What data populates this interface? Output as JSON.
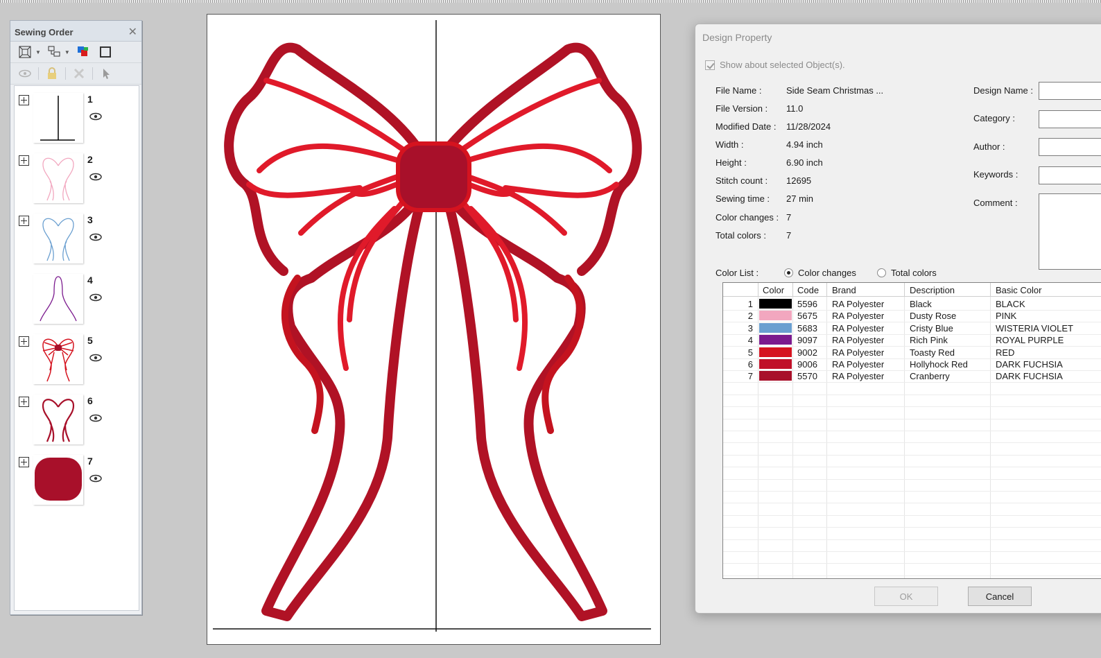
{
  "sewing_order": {
    "title": "Sewing Order",
    "layers": [
      {
        "num": "1",
        "icon": "black-line-thumb",
        "expandable": true
      },
      {
        "num": "2",
        "icon": "pink-outline-thumb",
        "expandable": true
      },
      {
        "num": "3",
        "icon": "blue-outline-thumb",
        "expandable": true
      },
      {
        "num": "4",
        "icon": "purple-outline-thumb",
        "expandable": false
      },
      {
        "num": "5",
        "icon": "red-bow-thumb",
        "expandable": true
      },
      {
        "num": "6",
        "icon": "dark-red-outline-thumb",
        "expandable": true
      },
      {
        "num": "7",
        "icon": "cranberry-fill-thumb",
        "expandable": true
      }
    ]
  },
  "dialog": {
    "title": "Design Property",
    "show_selected_label": "Show about selected Object(s).",
    "properties": [
      {
        "label": "File Name :",
        "value": "Side Seam Christmas ..."
      },
      {
        "label": "File Version :",
        "value": "11.0"
      },
      {
        "label": "Modified Date :",
        "value": "11/28/2024"
      },
      {
        "label": "Width :",
        "value": "4.94 inch"
      },
      {
        "label": "Height :",
        "value": "6.90 inch"
      },
      {
        "label": "Stitch count :",
        "value": "12695"
      },
      {
        "label": "Sewing time :",
        "value": "27 min"
      },
      {
        "label": "Color changes :",
        "value": "7"
      },
      {
        "label": "Total colors :",
        "value": "7"
      }
    ],
    "meta_fields": [
      {
        "label": "Design Name :",
        "value": ""
      },
      {
        "label": "Category :",
        "value": ""
      },
      {
        "label": "Author :",
        "value": ""
      },
      {
        "label": "Keywords :",
        "value": ""
      },
      {
        "label": "Comment :",
        "value": ""
      }
    ],
    "color_list_label": "Color List :",
    "radio_color_changes": "Color changes",
    "radio_total_colors": "Total colors",
    "columns": [
      "Color",
      "Code",
      "Brand",
      "Description",
      "Basic Color"
    ],
    "rows": [
      {
        "idx": "1",
        "swatch": "#000000",
        "code": "5596",
        "brand": "RA Polyester",
        "description": "Black",
        "basic": "BLACK"
      },
      {
        "idx": "2",
        "swatch": "#f2a7bf",
        "code": "5675",
        "brand": "RA Polyester",
        "description": "Dusty Rose",
        "basic": "PINK"
      },
      {
        "idx": "3",
        "swatch": "#6a9fd0",
        "code": "5683",
        "brand": "RA Polyester",
        "description": "Cristy Blue",
        "basic": "WISTERIA VIOLET"
      },
      {
        "idx": "4",
        "swatch": "#7b1a8e",
        "code": "9097",
        "brand": "RA Polyester",
        "description": "Rich Pink",
        "basic": "ROYAL PURPLE"
      },
      {
        "idx": "5",
        "swatch": "#d5131f",
        "code": "9002",
        "brand": "RA Polyester",
        "description": "Toasty Red",
        "basic": "RED"
      },
      {
        "idx": "6",
        "swatch": "#c01028",
        "code": "9006",
        "brand": "RA Polyester",
        "description": "Hollyhock Red",
        "basic": "DARK FUCHSIA"
      },
      {
        "idx": "7",
        "swatch": "#a8102a",
        "code": "5570",
        "brand": "RA Polyester",
        "description": "Cranberry",
        "basic": "DARK FUCHSIA"
      }
    ],
    "ok_label": "OK",
    "cancel_label": "Cancel"
  },
  "colors": {
    "bow_red": "#d5131f",
    "bow_dark": "#a8102a"
  }
}
